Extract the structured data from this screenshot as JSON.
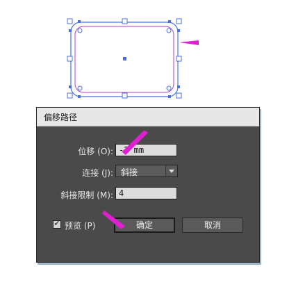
{
  "dialog": {
    "title": "偏移路径",
    "offset": {
      "label": "位移 (O):",
      "value": "-2 mm"
    },
    "joins": {
      "label": "连接 (J):",
      "value": "斜接"
    },
    "miter_limit": {
      "label": "斜接限制 (M):",
      "value": "4"
    },
    "preview": {
      "label": "预览 (P)",
      "checked": true
    },
    "ok_label": "确定",
    "cancel_label": "取消"
  },
  "colors": {
    "annotation_arrow": "#e020d0",
    "selection": "#4a6ee8",
    "offset_path": "#b040c0",
    "dialog_bg": "#4a4a4a"
  }
}
